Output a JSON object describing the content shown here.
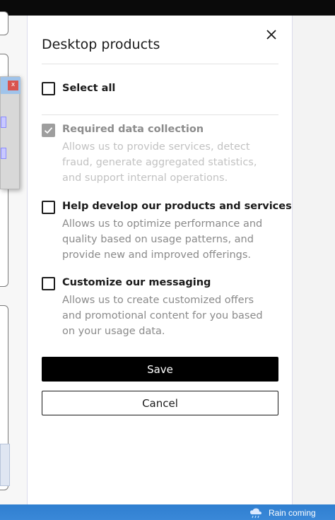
{
  "panel": {
    "title": "Desktop products",
    "select_all": {
      "label": "Select all",
      "checked": false
    },
    "options": [
      {
        "title": "Required data collection",
        "description": "Allows us to provide services, detect fraud, generate aggregated statistics, and support internal operations.",
        "checked": true,
        "disabled": true
      },
      {
        "title": "Help develop our products and services",
        "description": "Allows us to optimize performance and quality based on usage patterns, and provide new and improved offerings.",
        "checked": false,
        "disabled": false
      },
      {
        "title": "Customize our messaging",
        "description": "Allows us to create customized offers and promotional content for you based on your usage data.",
        "checked": false,
        "disabled": false
      }
    ],
    "save_label": "Save",
    "cancel_label": "Cancel"
  },
  "background_window": {
    "close_glyph": "x"
  },
  "taskbar": {
    "weather_text": "Rain coming",
    "weather_icon": "rain-cloud-icon"
  },
  "colors": {
    "save_bg": "#000000",
    "taskbar": "#3a88d8",
    "disabled_check": "#9e9e9e"
  }
}
